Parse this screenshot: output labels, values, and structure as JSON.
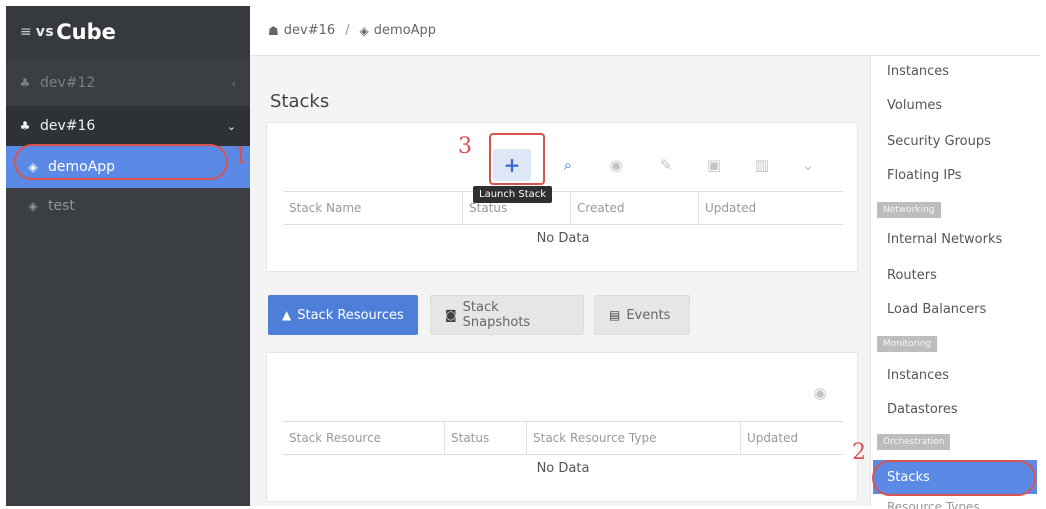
{
  "brand": {
    "menu_glyph": "≡",
    "prefix": "vs",
    "name": "Cube"
  },
  "sidebar": {
    "items": [
      {
        "label": "dev#12",
        "icon": "users-icon"
      },
      {
        "label": "dev#16",
        "icon": "users-icon"
      },
      {
        "label": "demoApp",
        "icon": "cube-icon"
      },
      {
        "label": "test",
        "icon": "cube-icon"
      }
    ]
  },
  "breadcrumb": {
    "project": "dev#16",
    "separator": "/",
    "app": "demoApp"
  },
  "main": {
    "title": "Stacks",
    "tooltip": "Launch Stack",
    "stack_table": {
      "columns": [
        "Stack Name",
        "Status",
        "Created",
        "Updated"
      ],
      "empty": "No Data"
    },
    "tabs": [
      "Stack Resources",
      "Stack Snapshots",
      "Events"
    ],
    "resource_table": {
      "columns": [
        "Stack Resource",
        "Status",
        "Stack Resource Type",
        "Updated"
      ],
      "empty": "No Data"
    }
  },
  "right_menu": {
    "items_top": [
      "Instances",
      "Volumes",
      "Security Groups",
      "Floating IPs"
    ],
    "header_networking": "Networking",
    "items_networking": [
      "Internal Networks",
      "Routers",
      "Load Balancers"
    ],
    "header_monitoring": "Monitoring",
    "items_monitoring": [
      "Instances",
      "Datastores"
    ],
    "header_orchestration": "Orchestration",
    "active": "Stacks",
    "cutoff": "Resource Types"
  },
  "annotations": {
    "one": "1",
    "two": "2",
    "three": "3"
  },
  "colors": {
    "accent": "#5b8ae6",
    "sidebar": "#3b3f44",
    "annotation": "#d9534f"
  }
}
